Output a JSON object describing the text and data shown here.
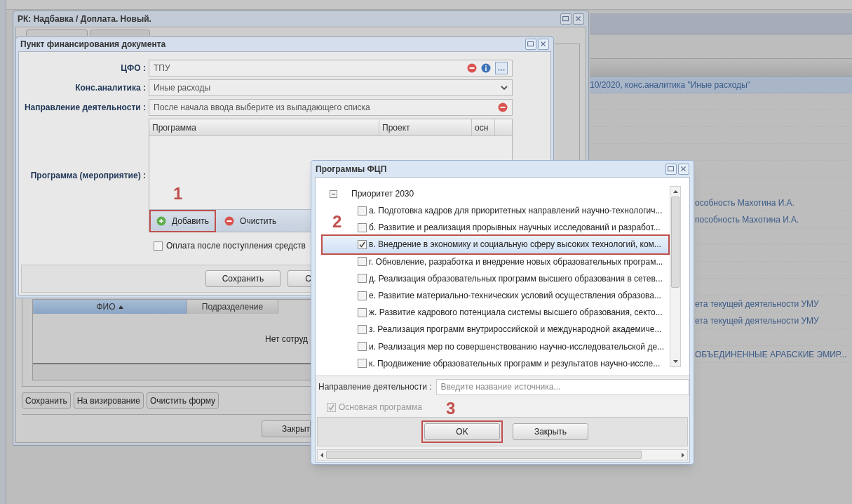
{
  "background": {
    "rows": [
      {
        "text": "10/2020, конс.аналитика \"Иные расходы\"",
        "selected": true
      },
      {
        "selected": false
      },
      {
        "selected": false
      },
      {
        "selected": false
      },
      {
        "selected": false
      },
      {
        "selected": false
      },
      {
        "selected": false
      },
      {
        "text": "особность Махотина И.А.",
        "selected": false
      },
      {
        "text": "пособность Махотина И.А.",
        "selected": false
      },
      {
        "selected": false
      },
      {
        "selected": false
      },
      {
        "selected": false
      },
      {
        "selected": false
      },
      {
        "text": "ета текущей деятельности УМУ",
        "selected": false
      },
      {
        "text": "ета текущей деятельности УМУ",
        "selected": false
      },
      {
        "selected": false
      },
      {
        "text": "ОБЪЕДИНЕННЫЕ АРАБСКИЕ ЭМИР...",
        "selected": false
      }
    ]
  },
  "main_window": {
    "title": "РК: Надбавка / Доплата. Новый.",
    "grid": {
      "columns": [
        {
          "label": "ФИО",
          "sorted": true
        },
        {
          "label": "Подразделение",
          "sorted": false
        }
      ],
      "empty_text": "Нет сотруд"
    },
    "buttons": [
      "Сохранить",
      "На визирование",
      "Очистить форму"
    ],
    "footer_buttons": [
      "Закрыт"
    ]
  },
  "finance_window": {
    "title": "Пункт финансирования документа",
    "fields": [
      {
        "kind": "lookup",
        "label": "ЦФО :",
        "value": "ТПУ"
      },
      {
        "kind": "combo",
        "label": "Конс.аналитика :",
        "value": "Иные расходы"
      },
      {
        "kind": "text",
        "label": "Направление деятельности :",
        "placeholder": "После начала ввода выберите из выпадающего списка"
      }
    ],
    "program_label": "Программа (мероприятие) :",
    "grid_columns": [
      "Программа",
      "Проект",
      "осн"
    ],
    "toolbar": [
      {
        "kind": "add",
        "label": "Добавить",
        "annotated": true
      },
      {
        "kind": "remove",
        "label": "Очистить",
        "annotated": false
      }
    ],
    "checkbox": {
      "label": "Оплата после поступления средств",
      "checked": false
    },
    "buttons": [
      "Сохранить",
      "С"
    ]
  },
  "fcp_dialog": {
    "title": "Программы ФЦП",
    "tree": {
      "label": "Приоритет 2030",
      "expanded": true,
      "children": [
        {
          "label": "а. Подготовка кадров для приоритетных направлений научно-технологич...",
          "checked": false,
          "selected": false
        },
        {
          "label": "б. Развитие и реализация прорывных научных исследований и разработ...",
          "checked": false,
          "selected": false
        },
        {
          "label": "в. Внедрение в экономику и социальную сферу высоких технологий, ком...",
          "checked": true,
          "selected": true
        },
        {
          "label": "г. Обновление, разработка и внедрение новых образовательных програм...",
          "checked": false,
          "selected": false
        },
        {
          "label": "д. Реализация образовательных программ высшего образования в сетев...",
          "checked": false,
          "selected": false
        },
        {
          "label": "е. Развитие материально-технических условий осуществления образова...",
          "checked": false,
          "selected": false
        },
        {
          "label": "ж. Развитие кадрового потенциала системы высшего образования, секто...",
          "checked": false,
          "selected": false
        },
        {
          "label": "з. Реализация программ внутрироссийской и международной академиче...",
          "checked": false,
          "selected": false
        },
        {
          "label": "и. Реализация мер по совершенствованию научно-исследовательской де...",
          "checked": false,
          "selected": false
        },
        {
          "label": "к. Продвижение образовательных программ и результатов научно-иссле...",
          "checked": false,
          "selected": false
        }
      ]
    },
    "direction": {
      "label": "Направление деятельности :",
      "placeholder": "Введите название источника..."
    },
    "main_program": {
      "label": "Основная программа",
      "checked": true,
      "disabled": true
    },
    "buttons": [
      {
        "label": "OK",
        "annotated": true
      },
      {
        "label": "Закрыть",
        "annotated": false
      }
    ]
  },
  "annotations": [
    {
      "label": "1"
    },
    {
      "label": "2"
    },
    {
      "label": "3"
    }
  ]
}
